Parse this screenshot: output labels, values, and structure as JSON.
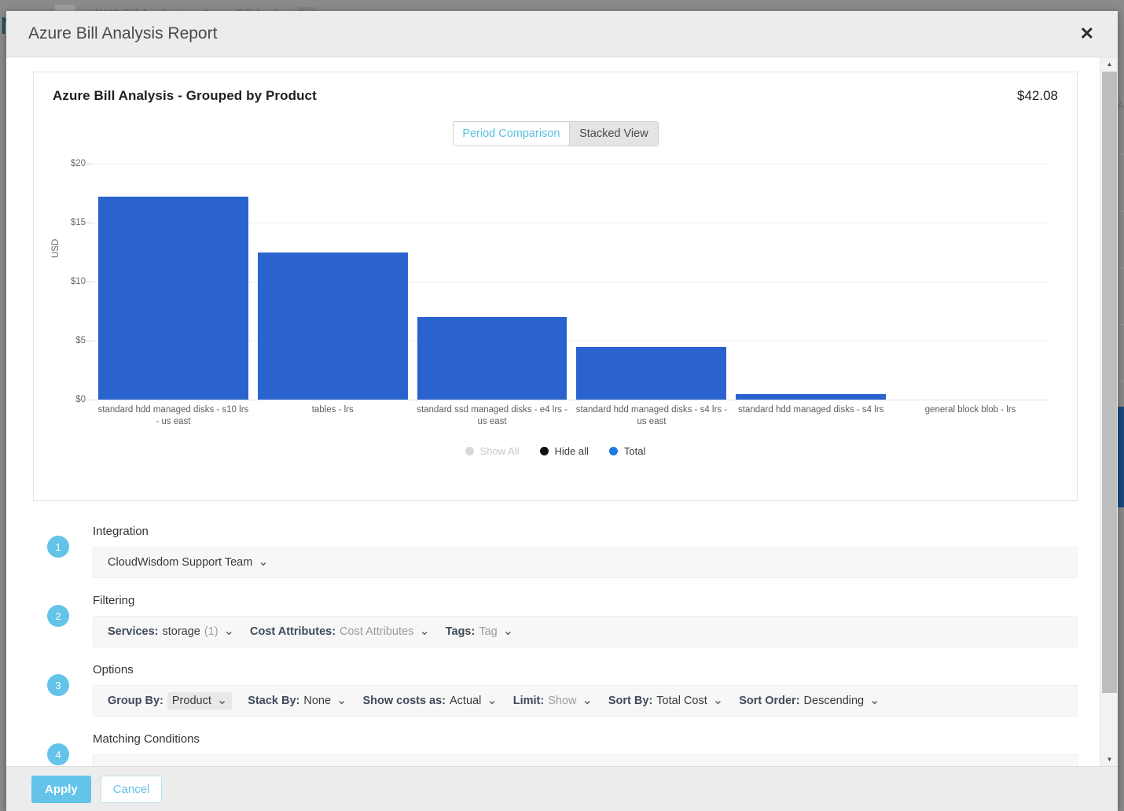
{
  "background": {
    "logo_text": "m",
    "tabs": [
      {
        "label": "AWS Bill Analysis",
        "badge": ""
      },
      {
        "label": "Azure Bill Analysis",
        "badge": "BETA"
      }
    ],
    "side_text": ")A"
  },
  "modal": {
    "title": "Azure Bill Analysis Report",
    "close_icon": "close-icon",
    "footer": {
      "apply_label": "Apply",
      "cancel_label": "Cancel"
    }
  },
  "chart_card": {
    "title": "Azure Bill Analysis - Grouped by Product",
    "total": "$42.08",
    "view_toggle": {
      "active": "Period Comparison",
      "inactive": "Stacked View"
    }
  },
  "chart_data": {
    "type": "bar",
    "title": "Azure Bill Analysis - Grouped by Product",
    "xlabel": "",
    "ylabel": "USD",
    "ylim": [
      0,
      20
    ],
    "yticks": [
      "$0",
      "$5",
      "$10",
      "$15",
      "$20"
    ],
    "grid": true,
    "legend_position": "bottom",
    "bar_color": "#2b63ce",
    "categories": [
      "standard hdd managed disks - s10 lrs - us east",
      "tables - lrs",
      "standard ssd managed disks - e4 lrs - us east",
      "standard hdd managed disks - s4 lrs - us east",
      "standard hdd managed disks - s4 lrs",
      "general block blob - lrs"
    ],
    "series": [
      {
        "name": "Total",
        "values": [
          17.2,
          12.5,
          7.0,
          4.5,
          0.45,
          0.0
        ]
      }
    ],
    "legend": [
      {
        "label": "Show All",
        "color": "#d8d8d8"
      },
      {
        "label": "Hide all",
        "color": "#111111"
      },
      {
        "label": "Total",
        "color": "#1f7ae0"
      }
    ]
  },
  "sections": [
    {
      "step": "1",
      "label": "Integration",
      "fields": [
        {
          "name": "",
          "value": "CloudWisdom Support Team",
          "muted": false,
          "count": "",
          "highlight": false
        }
      ]
    },
    {
      "step": "2",
      "label": "Filtering",
      "fields": [
        {
          "name": "Services:",
          "value": "storage",
          "muted": false,
          "count": "(1)",
          "highlight": false
        },
        {
          "name": "Cost Attributes:",
          "value": "Cost Attributes",
          "muted": true,
          "count": "",
          "highlight": false
        },
        {
          "name": "Tags:",
          "value": "Tag",
          "muted": true,
          "count": "",
          "highlight": false
        }
      ]
    },
    {
      "step": "3",
      "label": "Options",
      "fields": [
        {
          "name": "Group By:",
          "value": "Product",
          "muted": false,
          "count": "",
          "highlight": true
        },
        {
          "name": "Stack By:",
          "value": "None",
          "muted": false,
          "count": "",
          "highlight": false
        },
        {
          "name": "Show costs as:",
          "value": "Actual",
          "muted": false,
          "count": "",
          "highlight": false
        },
        {
          "name": "Limit:",
          "value": "Show",
          "muted": true,
          "count": "",
          "highlight": false
        },
        {
          "name": "Sort By:",
          "value": "Total Cost",
          "muted": false,
          "count": "",
          "highlight": false
        },
        {
          "name": "Sort Order:",
          "value": "Descending",
          "muted": false,
          "count": "",
          "highlight": false
        }
      ]
    },
    {
      "step": "4",
      "label": "Matching Conditions",
      "fields": []
    }
  ]
}
